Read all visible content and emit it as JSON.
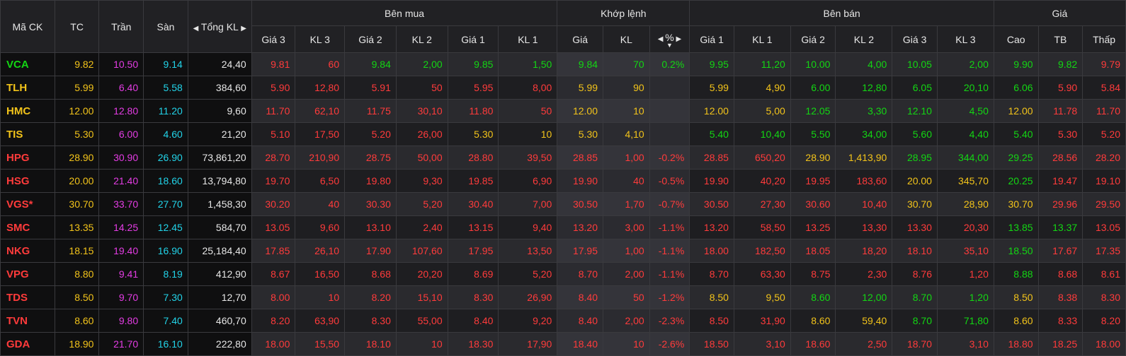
{
  "header": {
    "symbol": "Mã CK",
    "ref": "TC",
    "ceil": "Trần",
    "floor": "Sàn",
    "total_vol": "Tổng KL",
    "buy_group": "Bên mua",
    "match_group": "Khớp lệnh",
    "sell_group": "Bên bán",
    "price_group": "Giá",
    "buy_cols": [
      "Giá 3",
      "KL 3",
      "Giá 2",
      "KL 2",
      "Giá 1",
      "KL 1"
    ],
    "match_cols": [
      "Giá",
      "KL",
      "%"
    ],
    "sell_cols": [
      "Giá 1",
      "KL 1",
      "Giá 2",
      "KL 2",
      "Giá 3",
      "KL 3"
    ],
    "price_cols": [
      "Cao",
      "TB",
      "Thấp"
    ]
  },
  "colors": {
    "green": "#13d613",
    "red": "#ff3b3b",
    "yellow": "#f2c31a",
    "purple": "#e33ce3",
    "cyan": "#22d3e8",
    "white": "#e6e6e6"
  },
  "rows": [
    {
      "sym": "VCA",
      "symc": "green",
      "tc": "9.82",
      "tran": "10.50",
      "san": "9.14",
      "tkl": "24,40",
      "b": [
        [
          "9.81",
          "red"
        ],
        [
          "60",
          "red"
        ],
        [
          "9.84",
          "green"
        ],
        [
          "2,00",
          "green"
        ],
        [
          "9.85",
          "green"
        ],
        [
          "1,50",
          "green"
        ]
      ],
      "m": [
        [
          "9.84",
          "green"
        ],
        [
          "70",
          "green"
        ],
        [
          "0.2%",
          "green"
        ]
      ],
      "s": [
        [
          "9.95",
          "green"
        ],
        [
          "11,20",
          "green"
        ],
        [
          "10.00",
          "green"
        ],
        [
          "4,00",
          "green"
        ],
        [
          "10.05",
          "green"
        ],
        [
          "2,00",
          "green"
        ]
      ],
      "p": [
        [
          "9.90",
          "green"
        ],
        [
          "9.82",
          "green"
        ],
        [
          "9.79",
          "red"
        ]
      ]
    },
    {
      "sym": "TLH",
      "symc": "yellow",
      "tc": "5.99",
      "tran": "6.40",
      "san": "5.58",
      "tkl": "384,60",
      "b": [
        [
          "5.90",
          "red"
        ],
        [
          "12,80",
          "red"
        ],
        [
          "5.91",
          "red"
        ],
        [
          "50",
          "red"
        ],
        [
          "5.95",
          "red"
        ],
        [
          "8,00",
          "red"
        ]
      ],
      "m": [
        [
          "5.99",
          "yellow"
        ],
        [
          "90",
          "yellow"
        ],
        [
          "",
          "yellow"
        ]
      ],
      "s": [
        [
          "5.99",
          "yellow"
        ],
        [
          "4,90",
          "yellow"
        ],
        [
          "6.00",
          "green"
        ],
        [
          "12,80",
          "green"
        ],
        [
          "6.05",
          "green"
        ],
        [
          "20,10",
          "green"
        ]
      ],
      "p": [
        [
          "6.06",
          "green"
        ],
        [
          "5.90",
          "red"
        ],
        [
          "5.84",
          "red"
        ]
      ]
    },
    {
      "sym": "HMC",
      "symc": "yellow",
      "tc": "12.00",
      "tran": "12.80",
      "san": "11.20",
      "tkl": "9,60",
      "b": [
        [
          "11.70",
          "red"
        ],
        [
          "62,10",
          "red"
        ],
        [
          "11.75",
          "red"
        ],
        [
          "30,10",
          "red"
        ],
        [
          "11.80",
          "red"
        ],
        [
          "50",
          "red"
        ]
      ],
      "m": [
        [
          "12.00",
          "yellow"
        ],
        [
          "10",
          "yellow"
        ],
        [
          "",
          "yellow"
        ]
      ],
      "s": [
        [
          "12.00",
          "yellow"
        ],
        [
          "5,00",
          "yellow"
        ],
        [
          "12.05",
          "green"
        ],
        [
          "3,30",
          "green"
        ],
        [
          "12.10",
          "green"
        ],
        [
          "4,50",
          "green"
        ]
      ],
      "p": [
        [
          "12.00",
          "yellow"
        ],
        [
          "11.78",
          "red"
        ],
        [
          "11.70",
          "red"
        ]
      ]
    },
    {
      "sym": "TIS",
      "symc": "yellow",
      "tc": "5.30",
      "tran": "6.00",
      "san": "4.60",
      "tkl": "21,20",
      "b": [
        [
          "5.10",
          "red"
        ],
        [
          "17,50",
          "red"
        ],
        [
          "5.20",
          "red"
        ],
        [
          "26,00",
          "red"
        ],
        [
          "5.30",
          "yellow"
        ],
        [
          "10",
          "yellow"
        ]
      ],
      "m": [
        [
          "5.30",
          "yellow"
        ],
        [
          "4,10",
          "yellow"
        ],
        [
          "",
          "yellow"
        ]
      ],
      "s": [
        [
          "5.40",
          "green"
        ],
        [
          "10,40",
          "green"
        ],
        [
          "5.50",
          "green"
        ],
        [
          "34,00",
          "green"
        ],
        [
          "5.60",
          "green"
        ],
        [
          "4,40",
          "green"
        ]
      ],
      "p": [
        [
          "5.40",
          "green"
        ],
        [
          "5.30",
          "red"
        ],
        [
          "5.20",
          "red"
        ]
      ]
    },
    {
      "sym": "HPG",
      "symc": "red",
      "tc": "28.90",
      "tran": "30.90",
      "san": "26.90",
      "tkl": "73,861,20",
      "b": [
        [
          "28.70",
          "red"
        ],
        [
          "210,90",
          "red"
        ],
        [
          "28.75",
          "red"
        ],
        [
          "50,00",
          "red"
        ],
        [
          "28.80",
          "red"
        ],
        [
          "39,50",
          "red"
        ]
      ],
      "m": [
        [
          "28.85",
          "red"
        ],
        [
          "1,00",
          "red"
        ],
        [
          "-0.2%",
          "red"
        ]
      ],
      "s": [
        [
          "28.85",
          "red"
        ],
        [
          "650,20",
          "red"
        ],
        [
          "28.90",
          "yellow"
        ],
        [
          "1,413,90",
          "yellow"
        ],
        [
          "28.95",
          "green"
        ],
        [
          "344,00",
          "green"
        ]
      ],
      "p": [
        [
          "29.25",
          "green"
        ],
        [
          "28.56",
          "red"
        ],
        [
          "28.20",
          "red"
        ]
      ]
    },
    {
      "sym": "HSG",
      "symc": "red",
      "tc": "20.00",
      "tran": "21.40",
      "san": "18.60",
      "tkl": "13,794,80",
      "b": [
        [
          "19.70",
          "red"
        ],
        [
          "6,50",
          "red"
        ],
        [
          "19.80",
          "red"
        ],
        [
          "9,30",
          "red"
        ],
        [
          "19.85",
          "red"
        ],
        [
          "6,90",
          "red"
        ]
      ],
      "m": [
        [
          "19.90",
          "red"
        ],
        [
          "40",
          "red"
        ],
        [
          "-0.5%",
          "red"
        ]
      ],
      "s": [
        [
          "19.90",
          "red"
        ],
        [
          "40,20",
          "red"
        ],
        [
          "19.95",
          "red"
        ],
        [
          "183,60",
          "red"
        ],
        [
          "20.00",
          "yellow"
        ],
        [
          "345,70",
          "yellow"
        ]
      ],
      "p": [
        [
          "20.25",
          "green"
        ],
        [
          "19.47",
          "red"
        ],
        [
          "19.10",
          "red"
        ]
      ]
    },
    {
      "sym": "VGS*",
      "symc": "red",
      "tc": "30.70",
      "tran": "33.70",
      "san": "27.70",
      "tkl": "1,458,30",
      "b": [
        [
          "30.20",
          "red"
        ],
        [
          "40",
          "red"
        ],
        [
          "30.30",
          "red"
        ],
        [
          "5,20",
          "red"
        ],
        [
          "30.40",
          "red"
        ],
        [
          "7,00",
          "red"
        ]
      ],
      "m": [
        [
          "30.50",
          "red"
        ],
        [
          "1,70",
          "red"
        ],
        [
          "-0.7%",
          "red"
        ]
      ],
      "s": [
        [
          "30.50",
          "red"
        ],
        [
          "27,30",
          "red"
        ],
        [
          "30.60",
          "red"
        ],
        [
          "10,40",
          "red"
        ],
        [
          "30.70",
          "yellow"
        ],
        [
          "28,90",
          "yellow"
        ]
      ],
      "p": [
        [
          "30.70",
          "yellow"
        ],
        [
          "29.96",
          "red"
        ],
        [
          "29.50",
          "red"
        ]
      ]
    },
    {
      "sym": "SMC",
      "symc": "red",
      "tc": "13.35",
      "tran": "14.25",
      "san": "12.45",
      "tkl": "584,70",
      "b": [
        [
          "13.05",
          "red"
        ],
        [
          "9,60",
          "red"
        ],
        [
          "13.10",
          "red"
        ],
        [
          "2,40",
          "red"
        ],
        [
          "13.15",
          "red"
        ],
        [
          "9,40",
          "red"
        ]
      ],
      "m": [
        [
          "13.20",
          "red"
        ],
        [
          "3,00",
          "red"
        ],
        [
          "-1.1%",
          "red"
        ]
      ],
      "s": [
        [
          "13.20",
          "red"
        ],
        [
          "58,50",
          "red"
        ],
        [
          "13.25",
          "red"
        ],
        [
          "13,30",
          "red"
        ],
        [
          "13.30",
          "red"
        ],
        [
          "20,30",
          "red"
        ]
      ],
      "p": [
        [
          "13.85",
          "green"
        ],
        [
          "13.37",
          "green"
        ],
        [
          "13.05",
          "red"
        ]
      ]
    },
    {
      "sym": "NKG",
      "symc": "red",
      "tc": "18.15",
      "tran": "19.40",
      "san": "16.90",
      "tkl": "25,184,40",
      "b": [
        [
          "17.85",
          "red"
        ],
        [
          "26,10",
          "red"
        ],
        [
          "17.90",
          "red"
        ],
        [
          "107,60",
          "red"
        ],
        [
          "17.95",
          "red"
        ],
        [
          "13,50",
          "red"
        ]
      ],
      "m": [
        [
          "17.95",
          "red"
        ],
        [
          "1,00",
          "red"
        ],
        [
          "-1.1%",
          "red"
        ]
      ],
      "s": [
        [
          "18.00",
          "red"
        ],
        [
          "182,50",
          "red"
        ],
        [
          "18.05",
          "red"
        ],
        [
          "18,20",
          "red"
        ],
        [
          "18.10",
          "red"
        ],
        [
          "35,10",
          "red"
        ]
      ],
      "p": [
        [
          "18.50",
          "green"
        ],
        [
          "17.67",
          "red"
        ],
        [
          "17.35",
          "red"
        ]
      ]
    },
    {
      "sym": "VPG",
      "symc": "red",
      "tc": "8.80",
      "tran": "9.41",
      "san": "8.19",
      "tkl": "412,90",
      "b": [
        [
          "8.67",
          "red"
        ],
        [
          "16,50",
          "red"
        ],
        [
          "8.68",
          "red"
        ],
        [
          "20,20",
          "red"
        ],
        [
          "8.69",
          "red"
        ],
        [
          "5,20",
          "red"
        ]
      ],
      "m": [
        [
          "8.70",
          "red"
        ],
        [
          "2,00",
          "red"
        ],
        [
          "-1.1%",
          "red"
        ]
      ],
      "s": [
        [
          "8.70",
          "red"
        ],
        [
          "63,30",
          "red"
        ],
        [
          "8.75",
          "red"
        ],
        [
          "2,30",
          "red"
        ],
        [
          "8.76",
          "red"
        ],
        [
          "1,20",
          "red"
        ]
      ],
      "p": [
        [
          "8.88",
          "green"
        ],
        [
          "8.68",
          "red"
        ],
        [
          "8.61",
          "red"
        ]
      ]
    },
    {
      "sym": "TDS",
      "symc": "red",
      "tc": "8.50",
      "tran": "9.70",
      "san": "7.30",
      "tkl": "12,70",
      "b": [
        [
          "8.00",
          "red"
        ],
        [
          "10",
          "red"
        ],
        [
          "8.20",
          "red"
        ],
        [
          "15,10",
          "red"
        ],
        [
          "8.30",
          "red"
        ],
        [
          "26,90",
          "red"
        ]
      ],
      "m": [
        [
          "8.40",
          "red"
        ],
        [
          "50",
          "red"
        ],
        [
          "-1.2%",
          "red"
        ]
      ],
      "s": [
        [
          "8.50",
          "yellow"
        ],
        [
          "9,50",
          "yellow"
        ],
        [
          "8.60",
          "green"
        ],
        [
          "12,00",
          "green"
        ],
        [
          "8.70",
          "green"
        ],
        [
          "1,20",
          "green"
        ]
      ],
      "p": [
        [
          "8.50",
          "yellow"
        ],
        [
          "8.38",
          "red"
        ],
        [
          "8.30",
          "red"
        ]
      ]
    },
    {
      "sym": "TVN",
      "symc": "red",
      "tc": "8.60",
      "tran": "9.80",
      "san": "7.40",
      "tkl": "460,70",
      "b": [
        [
          "8.20",
          "red"
        ],
        [
          "63,90",
          "red"
        ],
        [
          "8.30",
          "red"
        ],
        [
          "55,00",
          "red"
        ],
        [
          "8.40",
          "red"
        ],
        [
          "9,20",
          "red"
        ]
      ],
      "m": [
        [
          "8.40",
          "red"
        ],
        [
          "2,00",
          "red"
        ],
        [
          "-2.3%",
          "red"
        ]
      ],
      "s": [
        [
          "8.50",
          "red"
        ],
        [
          "31,90",
          "red"
        ],
        [
          "8.60",
          "yellow"
        ],
        [
          "59,40",
          "yellow"
        ],
        [
          "8.70",
          "green"
        ],
        [
          "71,80",
          "green"
        ]
      ],
      "p": [
        [
          "8.60",
          "yellow"
        ],
        [
          "8.33",
          "red"
        ],
        [
          "8.20",
          "red"
        ]
      ]
    },
    {
      "sym": "GDA",
      "symc": "red",
      "tc": "18.90",
      "tran": "21.70",
      "san": "16.10",
      "tkl": "222,80",
      "b": [
        [
          "18.00",
          "red"
        ],
        [
          "15,50",
          "red"
        ],
        [
          "18.10",
          "red"
        ],
        [
          "10",
          "red"
        ],
        [
          "18.30",
          "red"
        ],
        [
          "17,90",
          "red"
        ]
      ],
      "m": [
        [
          "18.40",
          "red"
        ],
        [
          "10",
          "red"
        ],
        [
          "-2.6%",
          "red"
        ]
      ],
      "s": [
        [
          "18.50",
          "red"
        ],
        [
          "3,10",
          "red"
        ],
        [
          "18.60",
          "red"
        ],
        [
          "2,50",
          "red"
        ],
        [
          "18.70",
          "red"
        ],
        [
          "3,10",
          "red"
        ]
      ],
      "p": [
        [
          "18.80",
          "red"
        ],
        [
          "18.25",
          "red"
        ],
        [
          "18.00",
          "red"
        ]
      ]
    }
  ]
}
